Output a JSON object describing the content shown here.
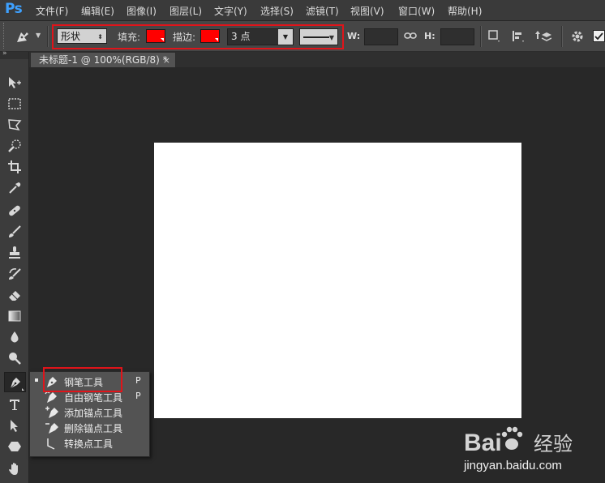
{
  "app": {
    "logo": "Ps"
  },
  "menu": [
    "文件(F)",
    "编辑(E)",
    "图像(I)",
    "图层(L)",
    "文字(Y)",
    "选择(S)",
    "滤镜(T)",
    "视图(V)",
    "窗口(W)",
    "帮助(H)"
  ],
  "options": {
    "mode_select": "形状",
    "fill_label": "填充:",
    "stroke_label": "描边:",
    "stroke_width": "3 点",
    "w_label": "W:",
    "h_label": "H:",
    "fill_color": "#ff0000",
    "stroke_color": "#ff0000"
  },
  "document": {
    "tab_title": "未标题-1 @ 100%(RGB/8) *",
    "close": "×"
  },
  "flyout": [
    {
      "label": "钢笔工具",
      "key": "P",
      "icon": "pen-icon",
      "selected": true
    },
    {
      "label": "自由钢笔工具",
      "key": "P",
      "icon": "freeform-pen-icon"
    },
    {
      "label": "添加锚点工具",
      "key": "",
      "icon": "add-anchor-icon"
    },
    {
      "label": "删除锚点工具",
      "key": "",
      "icon": "delete-anchor-icon"
    },
    {
      "label": "转换点工具",
      "key": "",
      "icon": "convert-point-icon"
    }
  ],
  "watermark": {
    "logo": "Bai经验",
    "sub": "jingyan.baidu.com"
  },
  "colors": {
    "highlight": "#e0141a",
    "accent": "#3ea1ff"
  }
}
